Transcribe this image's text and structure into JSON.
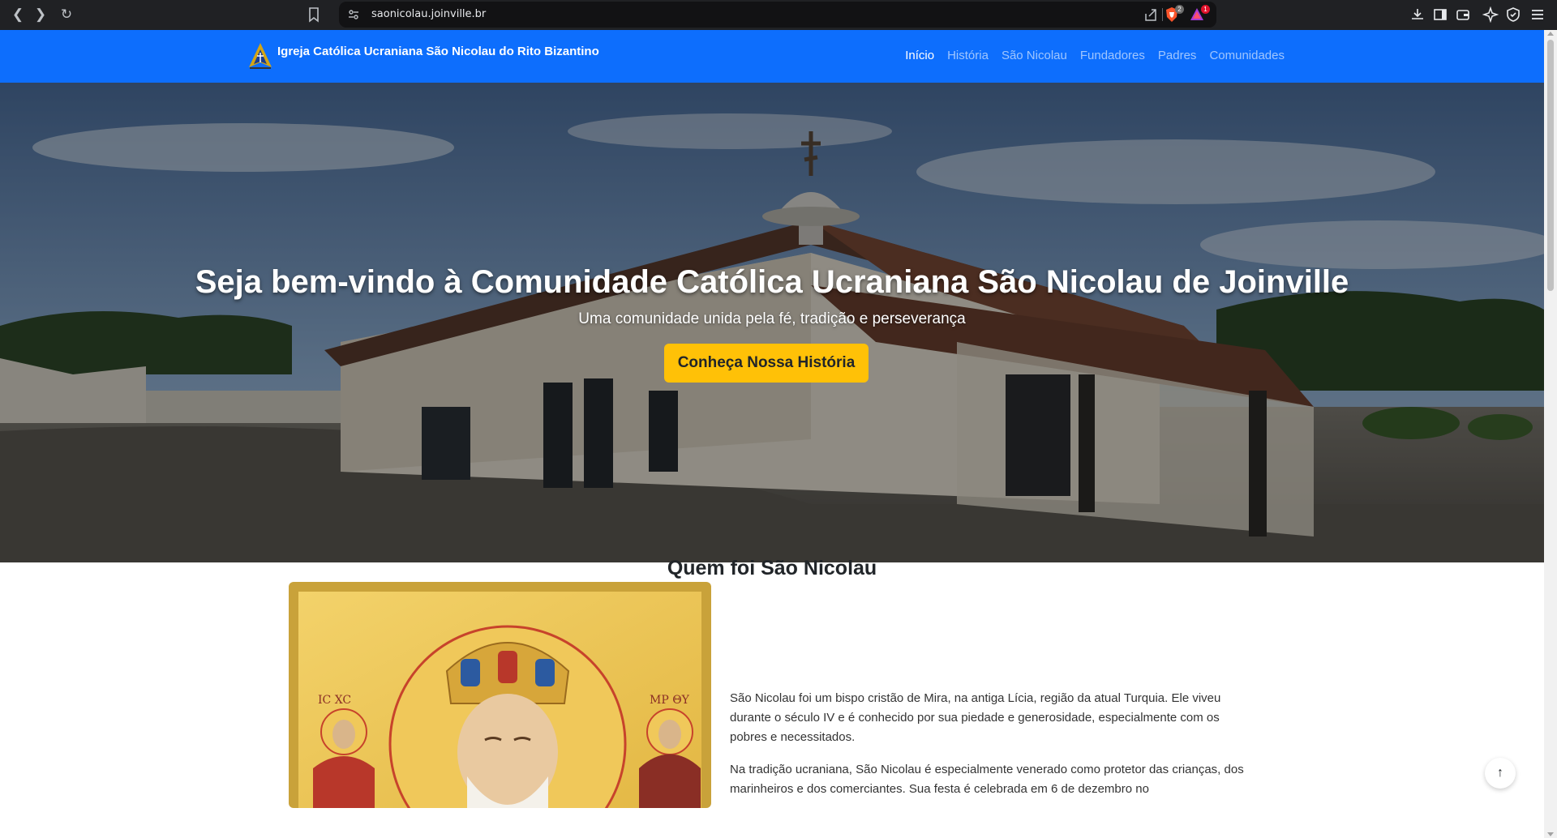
{
  "browser": {
    "url": "saonicolau.joinville.br",
    "brave_badge": "2",
    "rewards_badge": "1"
  },
  "navbar": {
    "brand": "Igreja Católica Ucraniana São Nicolau do Rito Bizantino",
    "items": [
      {
        "label": "Início",
        "active": true
      },
      {
        "label": "História"
      },
      {
        "label": "São Nicolau"
      },
      {
        "label": "Fundadores"
      },
      {
        "label": "Padres"
      },
      {
        "label": "Comunidades"
      }
    ]
  },
  "hero": {
    "title": "Seja bem-vindo à Comunidade Católica Ucraniana São Nicolau de Joinville",
    "subtitle": "Uma comunidade unida pela fé, tradição e perseverança",
    "cta": "Conheça Nossa História"
  },
  "section": {
    "title": "Quem foi São Nicolau",
    "paragraphs": [
      "São Nicolau foi um bispo cristão de Mira, na antiga Lícia, região da atual Turquia. Ele viveu durante o século IV e é conhecido por sua piedade e generosidade, especialmente com os pobres e necessitados.",
      "Na tradição ucraniana, São Nicolau é especialmente venerado como protetor das crianças, dos marinheiros e dos comerciantes. Sua festa é celebrada em 6 de dezembro no"
    ],
    "icon_left_label": "IC XC",
    "icon_right_label": "MP ΘY"
  },
  "scroll_top": "↑",
  "colors": {
    "navbar": "#0d6efd",
    "cta": "#ffc107",
    "gold": "#e8c04a"
  }
}
